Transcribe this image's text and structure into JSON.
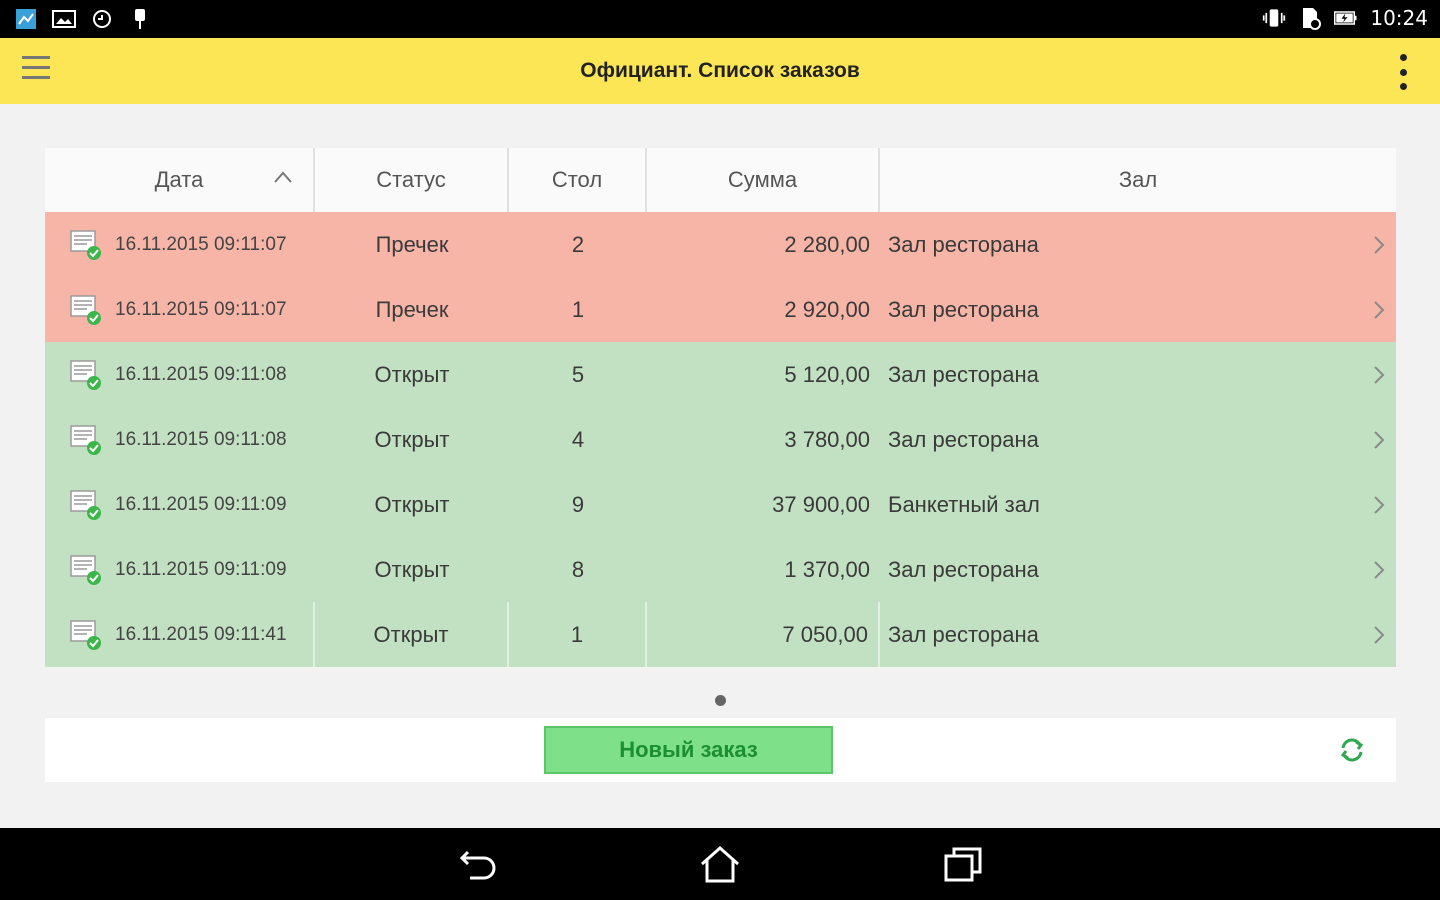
{
  "status_bar": {
    "time": "10:24",
    "left_icons": [
      "app-icon",
      "image-icon",
      "sync-icon",
      "usb-icon"
    ],
    "right_icons": [
      "vibrate-icon",
      "sd-card-icon",
      "battery-charging-icon"
    ]
  },
  "header": {
    "title": "Официант.  Список заказов"
  },
  "table": {
    "columns": [
      "Дата",
      "Статус",
      "Стол",
      "Сумма",
      "Зал"
    ],
    "rows": [
      {
        "date": "16.11.2015 09:11:07",
        "status": "Пречек",
        "table": "2",
        "sum": "2 280,00",
        "hall": "Зал ресторана",
        "color": "#f7b5a8"
      },
      {
        "date": "16.11.2015 09:11:07",
        "status": "Пречек",
        "table": "1",
        "sum": "2 920,00",
        "hall": "Зал ресторана",
        "color": "#f7b5a8"
      },
      {
        "date": "16.11.2015 09:11:08",
        "status": "Открыт",
        "table": "5",
        "sum": "5 120,00",
        "hall": "Зал ресторана",
        "color": "#c2e1c3"
      },
      {
        "date": "16.11.2015 09:11:08",
        "status": "Открыт",
        "table": "4",
        "sum": "3 780,00",
        "hall": "Зал ресторана",
        "color": "#c2e1c3"
      },
      {
        "date": "16.11.2015 09:11:09",
        "status": "Открыт",
        "table": "9",
        "sum": "37 900,00",
        "hall": "Банкетный зал",
        "color": "#c2e1c3"
      },
      {
        "date": "16.11.2015 09:11:09",
        "status": "Открыт",
        "table": "8",
        "sum": "1 370,00",
        "hall": "Зал ресторана",
        "color": "#c2e1c3"
      },
      {
        "date": "16.11.2015 09:11:41",
        "status": "Открыт",
        "table": "1",
        "sum": "7 050,00",
        "hall": "Зал ресторана",
        "color": "#c2e1c3"
      }
    ]
  },
  "footer": {
    "new_order_label": "Новый заказ"
  },
  "colors": {
    "title_bar": "#fce655",
    "prechek_row": "#f7b5a8",
    "open_row": "#c2e1c3",
    "button_green": "#7fe08a"
  }
}
